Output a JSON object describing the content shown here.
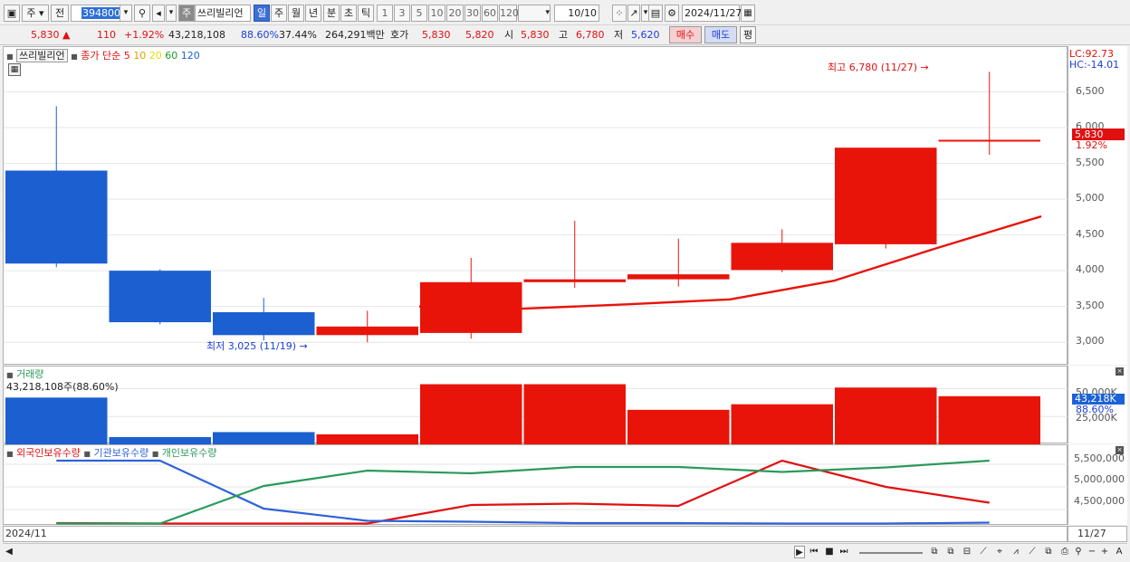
{
  "toolbar": {
    "market_type": "주",
    "range": "전",
    "stock_code": "394800",
    "stock_tag": "주",
    "stock_name": "쓰리빌리언",
    "periods": [
      "일",
      "주",
      "월",
      "년",
      "분",
      "초",
      "틱"
    ],
    "active_period": "일",
    "intervals": [
      "1",
      "3",
      "5",
      "10",
      "20",
      "30",
      "60",
      "120"
    ],
    "count": "10",
    "count_total": "/10",
    "date": "2024/11/27"
  },
  "quote": {
    "price": "5,830",
    "arrow": "▲",
    "change": "110",
    "change_pct": "+1.92%",
    "volume": "43,218,108",
    "vol_ratio": "88.60%",
    "turnover": "37.44%",
    "amount": "264,291백만",
    "ask_label": "호가",
    "ask1": "5,830",
    "ask2": "5,820",
    "open_label": "시",
    "open": "5,830",
    "high_label": "고",
    "high": "6,780",
    "low_label": "저",
    "low": "5,620",
    "buy": "매수",
    "sell": "매도",
    "eval": "평"
  },
  "price_pane": {
    "legend_name": "쓰리빌리언",
    "legend_ma_title": "종가 단순",
    "ma_periods": [
      "5",
      "10",
      "20",
      "60",
      "120"
    ],
    "ma_colors": [
      "#e01010",
      "#d9a300",
      "#e8d800",
      "#1a9c2a",
      "#1b62d6"
    ],
    "y_ticks": [
      "6,500",
      "6,000",
      "5,500",
      "5,000",
      "4,500",
      "4,000",
      "3,500",
      "3,000"
    ],
    "lc": "LC:92.73",
    "hc": "HC:-14.01",
    "last_price": "5,830",
    "last_pct": "1.92%",
    "high_note": "최고 6,780 (11/27)",
    "low_note": "최저 3,025 (11/19)"
  },
  "volume_pane": {
    "title": "거래량",
    "info": "43,218,108주(88.60%)",
    "y_ticks": [
      "50,000K",
      "25,000K"
    ],
    "last_value": "43,218K",
    "last_pct": "88.60%"
  },
  "holdings_pane": {
    "legend": [
      "외국인보유수량",
      "기관보유수량",
      "개인보유수량"
    ],
    "legend_colors": [
      "#e01010",
      "#2f62d6",
      "#2a9a5a"
    ],
    "y_ticks": [
      "5,500,000",
      "5,000,000",
      "4,500,000"
    ]
  },
  "date_axis": {
    "left": "2024/11",
    "right": "11/27"
  },
  "chart_data": [
    {
      "type": "candlestick",
      "title": "쓰리빌리언",
      "ylim": [
        2800,
        7000
      ],
      "candles": [
        {
          "open": 5400,
          "high": 6300,
          "low": 4050,
          "close": 4100
        },
        {
          "open": 4000,
          "high": 4020,
          "low": 3250,
          "close": 3280
        },
        {
          "open": 3420,
          "high": 3620,
          "low": 3025,
          "close": 3100
        },
        {
          "open": 3100,
          "high": 3440,
          "low": 3000,
          "close": 3220
        },
        {
          "open": 3130,
          "high": 4180,
          "low": 3050,
          "close": 3840
        },
        {
          "open": 3840,
          "high": 4700,
          "low": 3760,
          "close": 3880
        },
        {
          "open": 3880,
          "high": 4450,
          "low": 3780,
          "close": 3950
        },
        {
          "open": 4010,
          "high": 4580,
          "low": 3980,
          "close": 4390
        },
        {
          "open": 4370,
          "high": 4380,
          "low": 4310,
          "close": 5720
        },
        {
          "open": 5830,
          "high": 6780,
          "low": 5620,
          "close": 5830
        }
      ],
      "ma5": [
        null,
        null,
        null,
        null,
        3500,
        3470,
        3530,
        3600,
        3860,
        4320,
        4760
      ]
    },
    {
      "type": "bar",
      "title": "거래량",
      "values_k": [
        42000,
        6500,
        11000,
        9000,
        54000,
        54000,
        31000,
        36000,
        51000,
        43218
      ],
      "ylim": [
        0,
        65000
      ]
    },
    {
      "type": "line",
      "series": [
        {
          "name": "외국인보유수량",
          "values": [
            4200000,
            4190000,
            4190000,
            4190000,
            4600000,
            4630000,
            4580000,
            5580000,
            5000000,
            4650000
          ]
        },
        {
          "name": "기관보유수량",
          "values": [
            5580000,
            5580000,
            4520000,
            4250000,
            4230000,
            4200000,
            4200000,
            4190000,
            4190000,
            4210000
          ]
        },
        {
          "name": "개인보유수량",
          "values": [
            4190000,
            4190000,
            5020000,
            5360000,
            5300000,
            5440000,
            5440000,
            5330000,
            5430000,
            5580000
          ]
        }
      ],
      "ylim": [
        4180000,
        5800000
      ]
    }
  ]
}
